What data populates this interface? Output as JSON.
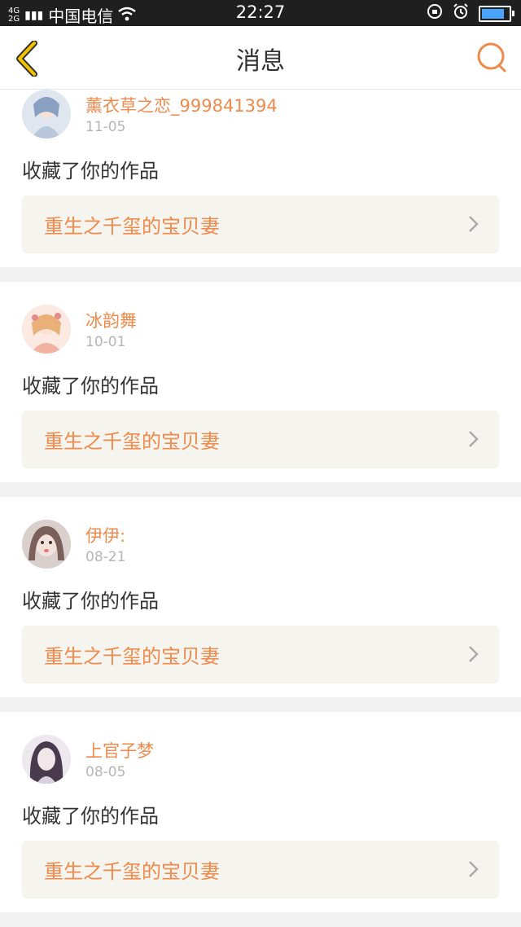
{
  "status_bar": {
    "network_top": "4G",
    "network_bottom": "2G",
    "carrier": "中国电信",
    "time": "22:27",
    "battery_level": 0.9
  },
  "header": {
    "title": "消息"
  },
  "colors": {
    "accent": "#f08a4b",
    "back_icon": "#f2c200",
    "work_bg": "#f5f4ef"
  },
  "messages": [
    {
      "username": "薰衣草之恋_999841394",
      "date": "11-05",
      "action": "收藏了你的作品",
      "work_title": "重生之千玺的宝贝妻"
    },
    {
      "username": "冰韵舞",
      "date": "10-01",
      "action": "收藏了你的作品",
      "work_title": "重生之千玺的宝贝妻"
    },
    {
      "username": "伊伊:",
      "date": "08-21",
      "action": "收藏了你的作品",
      "work_title": "重生之千玺的宝贝妻"
    },
    {
      "username": "上官子梦",
      "date": "08-05",
      "action": "收藏了你的作品",
      "work_title": "重生之千玺的宝贝妻"
    }
  ]
}
